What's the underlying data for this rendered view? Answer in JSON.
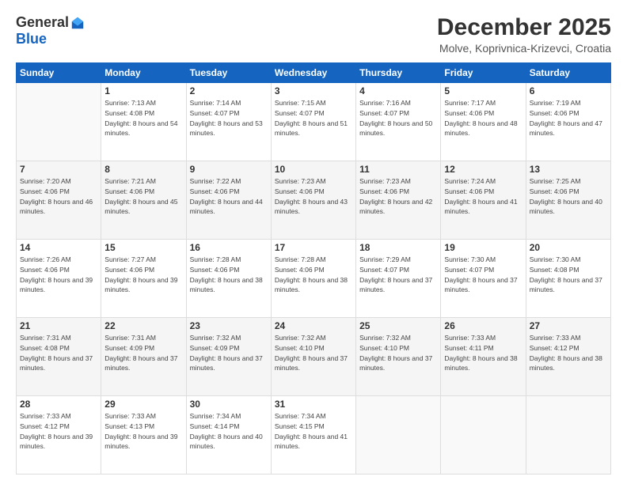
{
  "header": {
    "logo_general": "General",
    "logo_blue": "Blue",
    "month_title": "December 2025",
    "location": "Molve, Koprivnica-Krizevci, Croatia"
  },
  "days_of_week": [
    "Sunday",
    "Monday",
    "Tuesday",
    "Wednesday",
    "Thursday",
    "Friday",
    "Saturday"
  ],
  "weeks": [
    [
      {
        "day": "",
        "sunrise": "",
        "sunset": "",
        "daylight": ""
      },
      {
        "day": "1",
        "sunrise": "7:13 AM",
        "sunset": "4:08 PM",
        "daylight": "8 hours and 54 minutes."
      },
      {
        "day": "2",
        "sunrise": "7:14 AM",
        "sunset": "4:07 PM",
        "daylight": "8 hours and 53 minutes."
      },
      {
        "day": "3",
        "sunrise": "7:15 AM",
        "sunset": "4:07 PM",
        "daylight": "8 hours and 51 minutes."
      },
      {
        "day": "4",
        "sunrise": "7:16 AM",
        "sunset": "4:07 PM",
        "daylight": "8 hours and 50 minutes."
      },
      {
        "day": "5",
        "sunrise": "7:17 AM",
        "sunset": "4:06 PM",
        "daylight": "8 hours and 48 minutes."
      },
      {
        "day": "6",
        "sunrise": "7:19 AM",
        "sunset": "4:06 PM",
        "daylight": "8 hours and 47 minutes."
      }
    ],
    [
      {
        "day": "7",
        "sunrise": "7:20 AM",
        "sunset": "4:06 PM",
        "daylight": "8 hours and 46 minutes."
      },
      {
        "day": "8",
        "sunrise": "7:21 AM",
        "sunset": "4:06 PM",
        "daylight": "8 hours and 45 minutes."
      },
      {
        "day": "9",
        "sunrise": "7:22 AM",
        "sunset": "4:06 PM",
        "daylight": "8 hours and 44 minutes."
      },
      {
        "day": "10",
        "sunrise": "7:23 AM",
        "sunset": "4:06 PM",
        "daylight": "8 hours and 43 minutes."
      },
      {
        "day": "11",
        "sunrise": "7:23 AM",
        "sunset": "4:06 PM",
        "daylight": "8 hours and 42 minutes."
      },
      {
        "day": "12",
        "sunrise": "7:24 AM",
        "sunset": "4:06 PM",
        "daylight": "8 hours and 41 minutes."
      },
      {
        "day": "13",
        "sunrise": "7:25 AM",
        "sunset": "4:06 PM",
        "daylight": "8 hours and 40 minutes."
      }
    ],
    [
      {
        "day": "14",
        "sunrise": "7:26 AM",
        "sunset": "4:06 PM",
        "daylight": "8 hours and 39 minutes."
      },
      {
        "day": "15",
        "sunrise": "7:27 AM",
        "sunset": "4:06 PM",
        "daylight": "8 hours and 39 minutes."
      },
      {
        "day": "16",
        "sunrise": "7:28 AM",
        "sunset": "4:06 PM",
        "daylight": "8 hours and 38 minutes."
      },
      {
        "day": "17",
        "sunrise": "7:28 AM",
        "sunset": "4:06 PM",
        "daylight": "8 hours and 38 minutes."
      },
      {
        "day": "18",
        "sunrise": "7:29 AM",
        "sunset": "4:07 PM",
        "daylight": "8 hours and 37 minutes."
      },
      {
        "day": "19",
        "sunrise": "7:30 AM",
        "sunset": "4:07 PM",
        "daylight": "8 hours and 37 minutes."
      },
      {
        "day": "20",
        "sunrise": "7:30 AM",
        "sunset": "4:08 PM",
        "daylight": "8 hours and 37 minutes."
      }
    ],
    [
      {
        "day": "21",
        "sunrise": "7:31 AM",
        "sunset": "4:08 PM",
        "daylight": "8 hours and 37 minutes."
      },
      {
        "day": "22",
        "sunrise": "7:31 AM",
        "sunset": "4:09 PM",
        "daylight": "8 hours and 37 minutes."
      },
      {
        "day": "23",
        "sunrise": "7:32 AM",
        "sunset": "4:09 PM",
        "daylight": "8 hours and 37 minutes."
      },
      {
        "day": "24",
        "sunrise": "7:32 AM",
        "sunset": "4:10 PM",
        "daylight": "8 hours and 37 minutes."
      },
      {
        "day": "25",
        "sunrise": "7:32 AM",
        "sunset": "4:10 PM",
        "daylight": "8 hours and 37 minutes."
      },
      {
        "day": "26",
        "sunrise": "7:33 AM",
        "sunset": "4:11 PM",
        "daylight": "8 hours and 38 minutes."
      },
      {
        "day": "27",
        "sunrise": "7:33 AM",
        "sunset": "4:12 PM",
        "daylight": "8 hours and 38 minutes."
      }
    ],
    [
      {
        "day": "28",
        "sunrise": "7:33 AM",
        "sunset": "4:12 PM",
        "daylight": "8 hours and 39 minutes."
      },
      {
        "day": "29",
        "sunrise": "7:33 AM",
        "sunset": "4:13 PM",
        "daylight": "8 hours and 39 minutes."
      },
      {
        "day": "30",
        "sunrise": "7:34 AM",
        "sunset": "4:14 PM",
        "daylight": "8 hours and 40 minutes."
      },
      {
        "day": "31",
        "sunrise": "7:34 AM",
        "sunset": "4:15 PM",
        "daylight": "8 hours and 41 minutes."
      },
      {
        "day": "",
        "sunrise": "",
        "sunset": "",
        "daylight": ""
      },
      {
        "day": "",
        "sunrise": "",
        "sunset": "",
        "daylight": ""
      },
      {
        "day": "",
        "sunrise": "",
        "sunset": "",
        "daylight": ""
      }
    ]
  ]
}
